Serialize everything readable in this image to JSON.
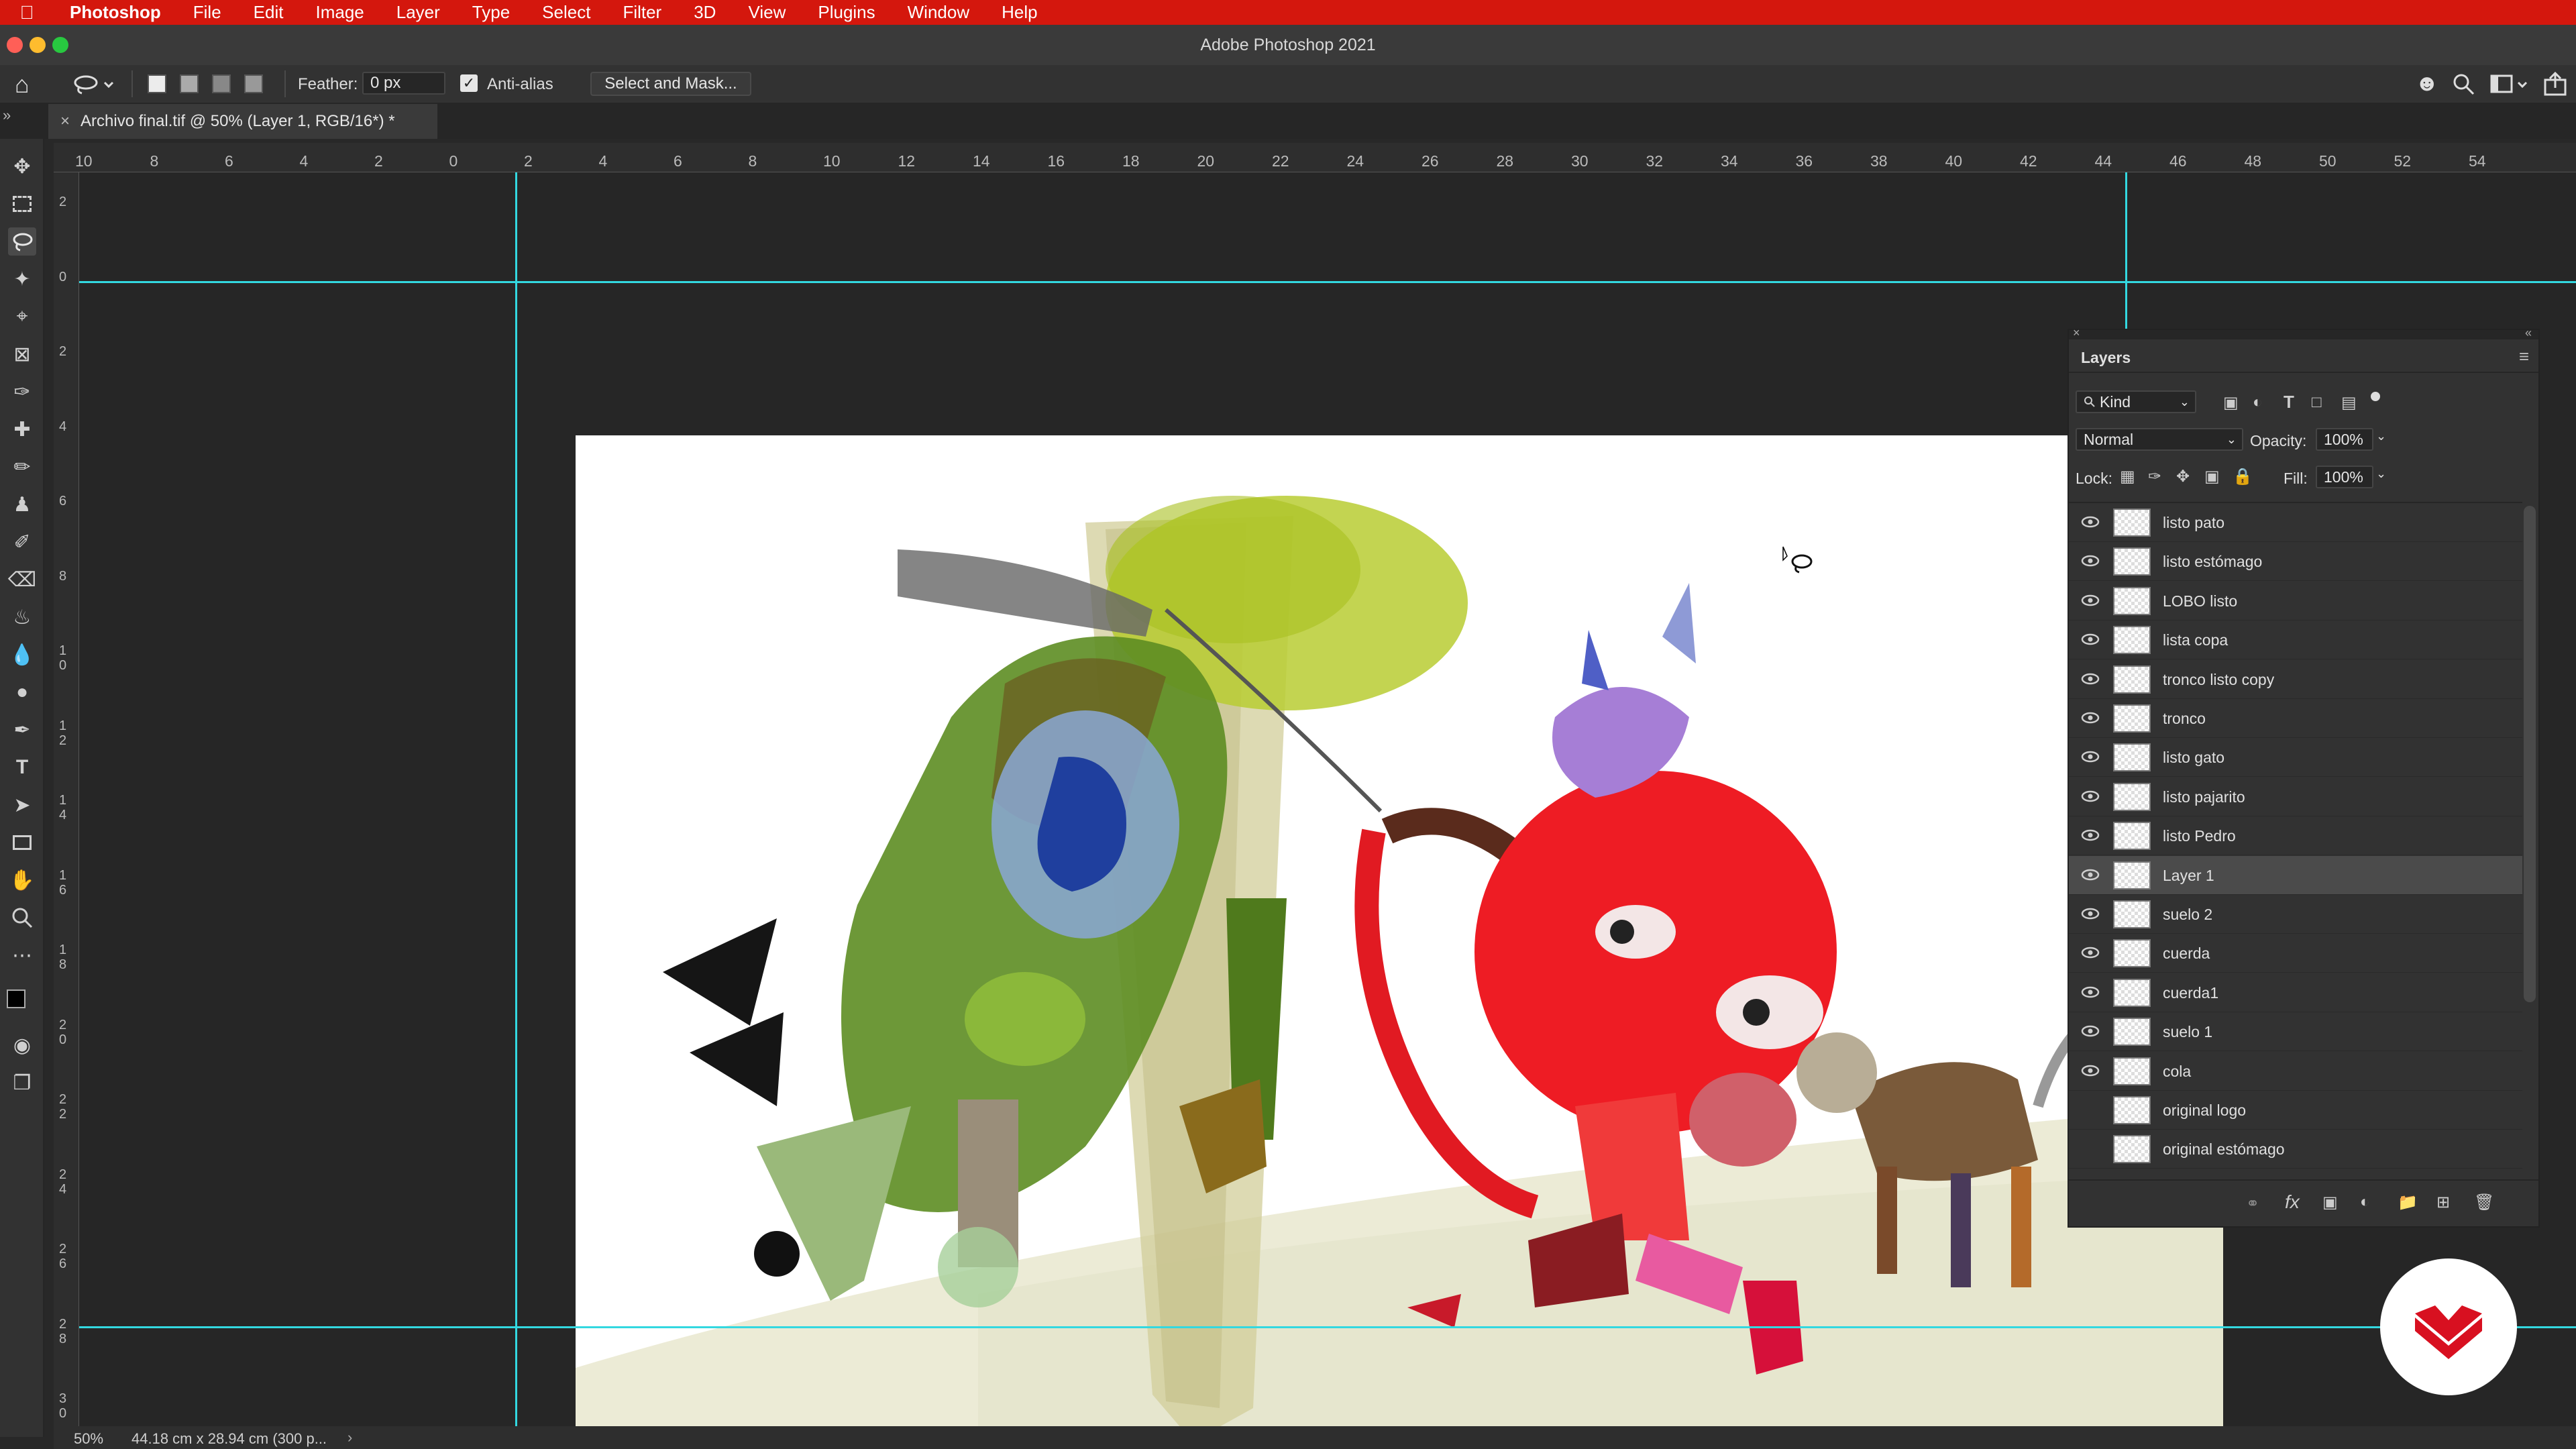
{
  "menubar": {
    "app": "Photoshop",
    "items": [
      "File",
      "Edit",
      "Image",
      "Layer",
      "Type",
      "Select",
      "Filter",
      "3D",
      "View",
      "Plugins",
      "Window",
      "Help"
    ]
  },
  "window": {
    "title": "Adobe Photoshop 2021"
  },
  "options": {
    "feather_label": "Feather:",
    "feather_value": "0 px",
    "antialias_label": "Anti-alias",
    "select_mask_label": "Select and Mask..."
  },
  "doc": {
    "tab_title": "Archivo final.tif @ 50% (Layer 1, RGB/16*) *"
  },
  "ruler": {
    "h": [
      "10",
      "8",
      "6",
      "4",
      "2",
      "0",
      "2",
      "4",
      "6",
      "8",
      "10",
      "12",
      "14",
      "16",
      "18",
      "20",
      "22",
      "24",
      "26",
      "28",
      "30",
      "32",
      "34",
      "36",
      "38",
      "40",
      "42",
      "44",
      "46",
      "48",
      "50",
      "52",
      "54"
    ],
    "v": [
      "2",
      "0",
      "2",
      "4",
      "6",
      "8",
      "10",
      "12",
      "14",
      "16",
      "18",
      "20",
      "22",
      "24",
      "26",
      "28",
      "30"
    ]
  },
  "status": {
    "zoom": "50%",
    "info": "44.18 cm x 28.94 cm (300 p... "
  },
  "layers_panel": {
    "title": "Layers",
    "kind_label": "Kind",
    "blend_mode": "Normal",
    "opacity_label": "Opacity:",
    "opacity_value": "100%",
    "lock_label": "Lock:",
    "fill_label": "Fill:",
    "fill_value": "100%",
    "layers": [
      {
        "name": "listo pato",
        "visible": true
      },
      {
        "name": "listo estómago",
        "visible": true
      },
      {
        "name": "LOBO listo",
        "visible": true
      },
      {
        "name": "lista copa",
        "visible": true
      },
      {
        "name": "tronco listo copy",
        "visible": true
      },
      {
        "name": "tronco",
        "visible": true
      },
      {
        "name": "listo gato",
        "visible": true
      },
      {
        "name": "listo pajarito",
        "visible": true
      },
      {
        "name": "listo Pedro",
        "visible": true
      },
      {
        "name": "Layer 1",
        "visible": true,
        "selected": true
      },
      {
        "name": "suelo 2",
        "visible": true
      },
      {
        "name": "cuerda",
        "visible": true
      },
      {
        "name": "cuerda1",
        "visible": true
      },
      {
        "name": "suelo 1",
        "visible": true
      },
      {
        "name": "cola",
        "visible": true
      },
      {
        "name": "original logo",
        "visible": false
      },
      {
        "name": "original estómago",
        "visible": false
      }
    ]
  },
  "colors": {
    "menubar": "#d4170d",
    "guide": "#33d8e0",
    "brand": "#d81020"
  }
}
